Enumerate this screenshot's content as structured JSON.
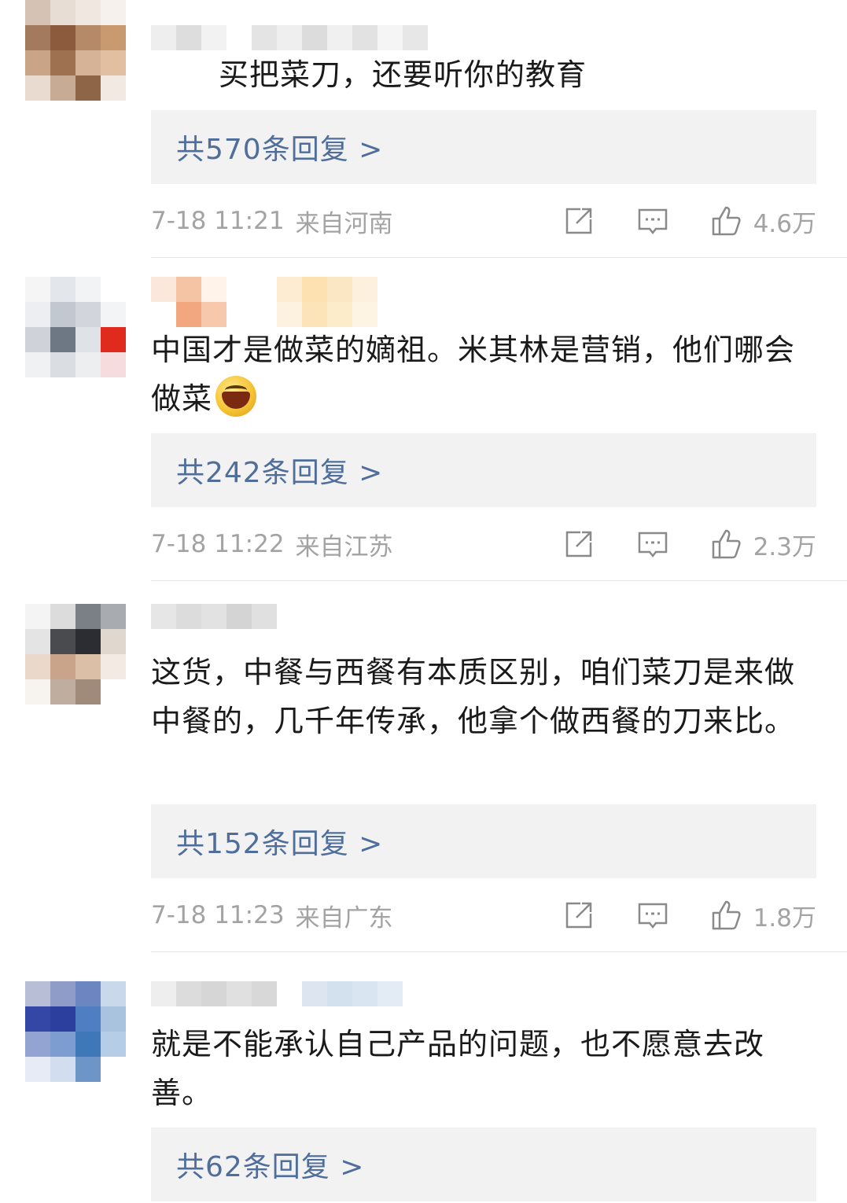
{
  "comments": [
    {
      "text": "买把菜刀，还要听你的教育",
      "replies": "共570条回复 >",
      "time": "7-18 11:21",
      "location": "来自河南",
      "likes": "4.6万"
    },
    {
      "text": "中国才是做菜的嫡祖。米其林是营销，他们哪会做菜",
      "emoji": "laughing-emoji",
      "replies": "共242条回复 >",
      "time": "7-18 11:22",
      "location": "来自江苏",
      "likes": "2.3万"
    },
    {
      "text": "这货，中餐与西餐有本质区别，咱们菜刀是来做中餐的，几千年传承，他拿个做西餐的刀来比。",
      "replies": "共152条回复 >",
      "time": "7-18 11:23",
      "location": "来自广东",
      "likes": "1.8万"
    },
    {
      "text": "就是不能承认自己产品的问题，也不愿意去改善。",
      "replies": "共62条回复 >"
    }
  ],
  "icons": {
    "share": "share-icon",
    "reply": "comment-icon",
    "like": "thumbs-up-icon"
  },
  "colors": {
    "link": "#4f6e9b",
    "meta": "#a3a3a3",
    "reply_bg": "#f2f2f2"
  }
}
